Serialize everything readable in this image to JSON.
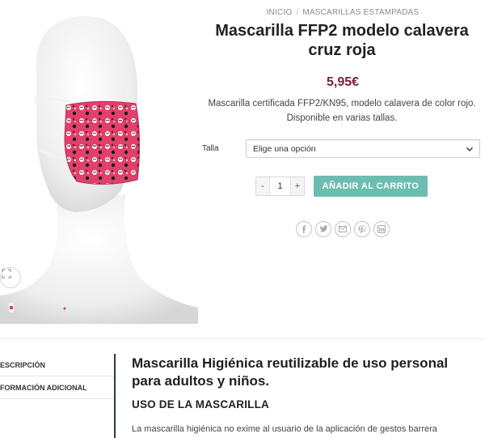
{
  "breadcrumb": {
    "home": "INICIO",
    "separator": "/",
    "category": "MASCARILLAS ESTAMPADAS"
  },
  "product": {
    "title": "Mascarilla FFP2 modelo calavera cruz roja",
    "price": "5,95€",
    "description": "Mascarilla certificada FFP2/KN95, modelo calavera de color rojo. Disponible en varias tallas."
  },
  "variation": {
    "label": "Talla",
    "select_value": "Elige una opción"
  },
  "cart": {
    "minus": "-",
    "quantity": "1",
    "plus": "+",
    "button_label": "AÑADIR AL CARRITO"
  },
  "share_icons": [
    "facebook-icon",
    "twitter-icon",
    "email-icon",
    "pinterest-icon",
    "linkedin-icon"
  ],
  "tabs": [
    {
      "label": "ESCRIPCIÓN"
    },
    {
      "label": "FORMACIÓN ADICIONAL"
    }
  ],
  "content": {
    "heading": "Mascarilla Higiénica reutilizable de uso personal para adultos y niños.",
    "subheading": "USO DE LA MASCARILLA",
    "paragraph": "La mascarilla higiénica no exime al usuario de la aplicación de gestos barrera"
  },
  "colors": {
    "price": "#7a1e3a",
    "cart_button": "#6cbdb0",
    "mask": "#e0406a"
  }
}
